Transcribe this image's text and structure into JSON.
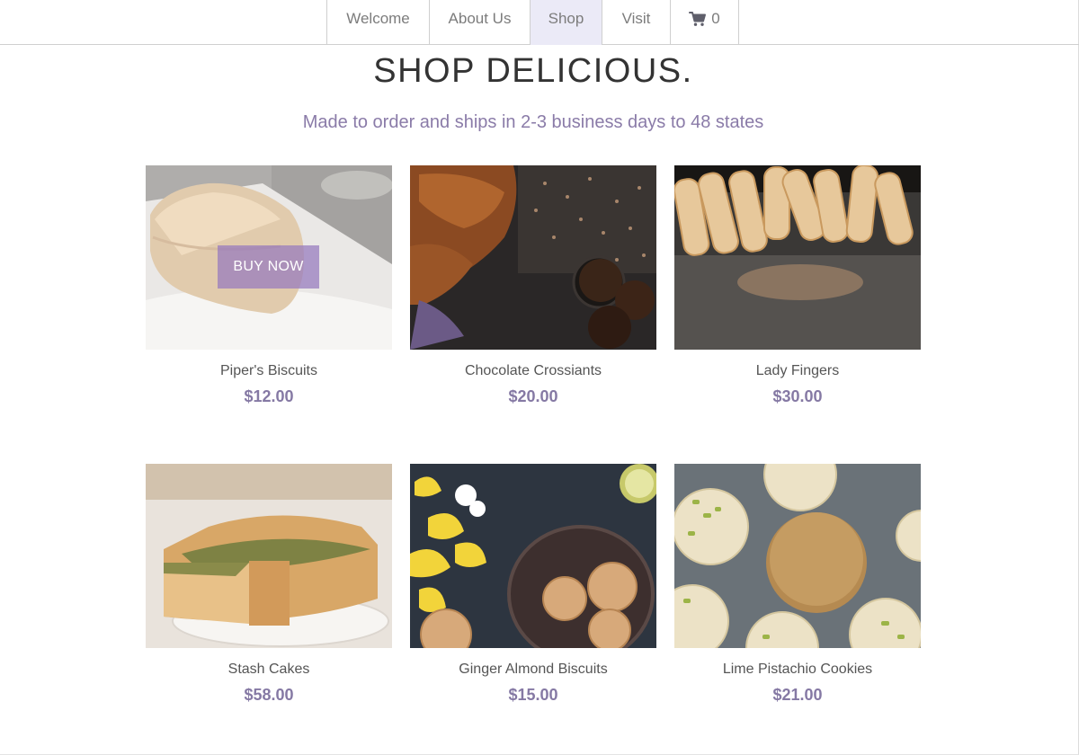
{
  "nav": {
    "items": [
      {
        "label": "Welcome"
      },
      {
        "label": "About Us"
      },
      {
        "label": "Shop"
      },
      {
        "label": "Visit"
      }
    ],
    "cart": {
      "icon": "cart-icon",
      "count": "0"
    },
    "active_item": "Shop"
  },
  "header": {
    "title": "SHOP DELICIOUS.",
    "subtitle": "Made to order and ships in 2-3 business days to 48 states"
  },
  "products": [
    {
      "name": "Piper's Biscuits",
      "price": "$12.00",
      "button": "BUY NOW"
    },
    {
      "name": "Chocolate Crossiants",
      "price": "$20.00"
    },
    {
      "name": "Lady Fingers",
      "price": "$30.00"
    },
    {
      "name": "Stash Cakes",
      "price": "$58.00"
    },
    {
      "name": "Ginger Almond Biscuits",
      "price": "$15.00"
    },
    {
      "name": "Lime Pistachio Cookies",
      "price": "$21.00"
    }
  ],
  "colors": {
    "accent": "#8579a4",
    "nav_active_bg": "#ebeaf7",
    "buy_button": "#9678be"
  }
}
